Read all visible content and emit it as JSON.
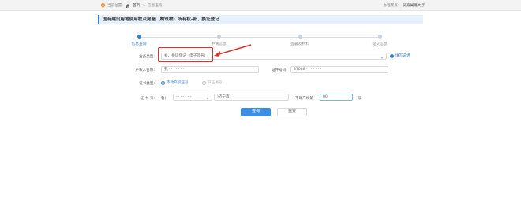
{
  "topbar": {
    "location_label": "当前位置:",
    "home": "首页",
    "sep": ">",
    "current": "信息查询",
    "hall_label": "办理网点:",
    "hall_name": "吴泰闸路大厅"
  },
  "page_title": "国有建设用地使用权及房屋（构筑物）所有权-补、换证登记",
  "steps": [
    {
      "label": "信息查询",
      "active": true
    },
    {
      "label": "申请信息",
      "active": false
    },
    {
      "label": "签署及材料",
      "active": false
    },
    {
      "label": "提交信息",
      "active": false
    }
  ],
  "form": {
    "business_type_label": "业务类型:",
    "business_type_value": "补、换证登记（电子签名）",
    "info_link": "填写说明",
    "owner_name_label": "产权人名称:",
    "owner_name_value": "孔 · · · · · · ·",
    "id_number_label": "证件号码:",
    "id_number_value": "37088 · · · · · · ·",
    "cert_type_label": "证书类型:",
    "cert_type_options": [
      "不动产权证号",
      "旧证书号"
    ],
    "cert_no_label": "证 书 号:",
    "cert_no_prefix": "鲁(",
    "cert_no_year": "- · · · · · -",
    "cert_no_city": ")济宁市",
    "property_no_label": "不动产权第",
    "property_no_value": "00____",
    "property_no_suffix": "号"
  },
  "buttons": {
    "query": "查询",
    "reset": "重置"
  },
  "colors": {
    "accent": "#2f7cd6",
    "annotation_red": "#d9322a"
  }
}
